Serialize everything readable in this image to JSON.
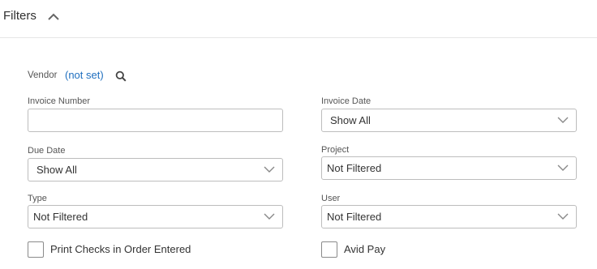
{
  "header": {
    "title": "Filters",
    "collapse_icon": "chevron-up-icon"
  },
  "vendor": {
    "label": "Vendor",
    "value": "(not set)",
    "search_icon": "search-icon"
  },
  "fields": {
    "invoice_number": {
      "label": "Invoice Number",
      "value": ""
    },
    "invoice_date": {
      "label": "Invoice Date",
      "value": "Show All"
    },
    "due_date": {
      "label": "Due Date",
      "value": "Show All"
    },
    "project": {
      "label": "Project",
      "value": "Not Filtered"
    },
    "type": {
      "label": "Type",
      "value": "Not Filtered"
    },
    "user": {
      "label": "User",
      "value": "Not Filtered"
    }
  },
  "checkboxes": {
    "print_checks": {
      "label": "Print Checks in Order Entered",
      "checked": false
    },
    "avid_pay": {
      "label": "Avid Pay",
      "checked": false
    }
  },
  "colors": {
    "link": "#1f6fbf",
    "border": "#bdbdbd",
    "text": "#333333"
  }
}
